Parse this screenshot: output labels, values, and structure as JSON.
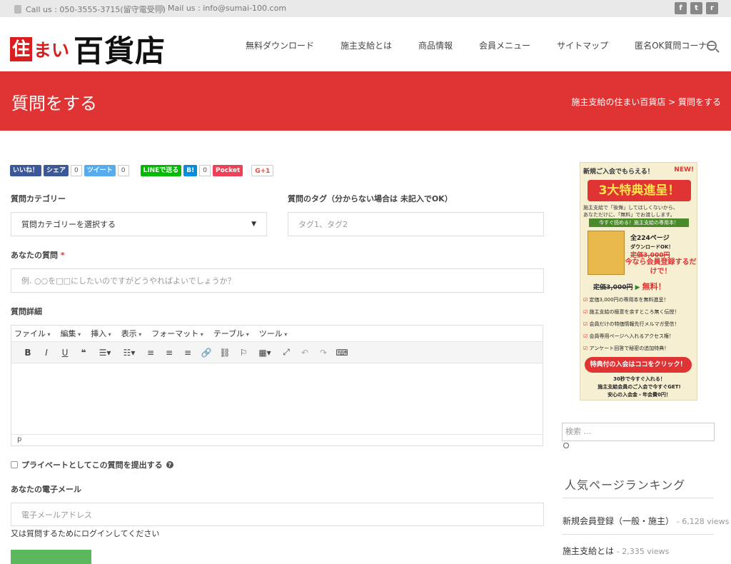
{
  "topbar": {
    "call": "Call us : 050-3555-3715(留守電受付)",
    "mail": "Mail us : info@sumai-100.com",
    "social": [
      "f",
      "t",
      "r"
    ]
  },
  "logo": {
    "box": "住",
    "mai": "まい",
    "main": "百貨店"
  },
  "nav": [
    "無料ダウンロード",
    "施主支給とは",
    "商品情報",
    "会員メニュー",
    "サイトマップ",
    "匿名OK質問コーナー"
  ],
  "banner": {
    "title": "質問をする",
    "breadcrumb": "施主支給の住まい百貨店 > 質問をする"
  },
  "share": {
    "like": "いいね！",
    "share": "シェア",
    "share_count": "0",
    "tweet": "ツイート",
    "tweet_count": "0",
    "line": "LINEで送る",
    "hatena": "B!",
    "hatena_count": "0",
    "pocket": "Pocket",
    "gplus": "G+1"
  },
  "form": {
    "category_label": "質問カテゴリー",
    "category_value": "質問カテゴリーを選択する",
    "tags_label": "質問のタグ（分からない場合は 未記入でOK）",
    "tags_placeholder": "タグ1、タグ2",
    "question_label": "あなたの質問",
    "required_mark": "*",
    "question_placeholder": "例. ○○を□□にしたいのですがどうやればよいでしょうか？",
    "detail_label": "質問詳細",
    "private_label": "プライベートとしてこの質問を提出する",
    "email_label": "あなたの電子メール",
    "email_placeholder": "電子メールアドレス",
    "login_note": "又は質問するためにログインしてください"
  },
  "editor": {
    "menus": [
      "ファイル",
      "編集",
      "挿入",
      "表示",
      "フォーマット",
      "テーブル",
      "ツール"
    ],
    "status": "p"
  },
  "ad": {
    "top": "新規ご入会でもらえる！",
    "new": "NEW!",
    "headline": "3大特典進呈！",
    "sub1": "施主支給で「後悔」してほしくないから、",
    "sub2": "あなただけに、「無料」でお渡しします。",
    "strip": "今すぐ読める！施主支給の専用本！",
    "pages": "全224ページ",
    "dl": "ダウンロードOK！",
    "price": "定価3,000円",
    "now": "今なら会員登録するだけで！",
    "free_price": "定価3,000円",
    "free": "無料！",
    "checks": [
      "定価3,000円の専用本を無料進呈！",
      "施主支給の極意を余すところ無く伝授！",
      "会員だけの特価情報先行メルマガ受信！",
      "会員専用ページへ入れるアクセス権！",
      "アンケート回答で秘密の追加特典！"
    ],
    "cta": "特典付の入会はココをクリック！",
    "foot1": "30秒で今すぐ入れる！",
    "foot2": "施主支給会員のご入会で今すぐGET!",
    "foot3": "安心の入会金・年会費0円！"
  },
  "sidebar": {
    "search_placeholder": "検索 …",
    "ranking_title": "人気ページランキング",
    "ranking": [
      {
        "title": "新規会員登録（一般・施主）",
        "views": "- 6,128 views"
      },
      {
        "title": "施主支給とは",
        "views": "- 2,335 views"
      }
    ]
  },
  "colors": {
    "accent": "#e03333",
    "submit": "#5cb85c"
  }
}
